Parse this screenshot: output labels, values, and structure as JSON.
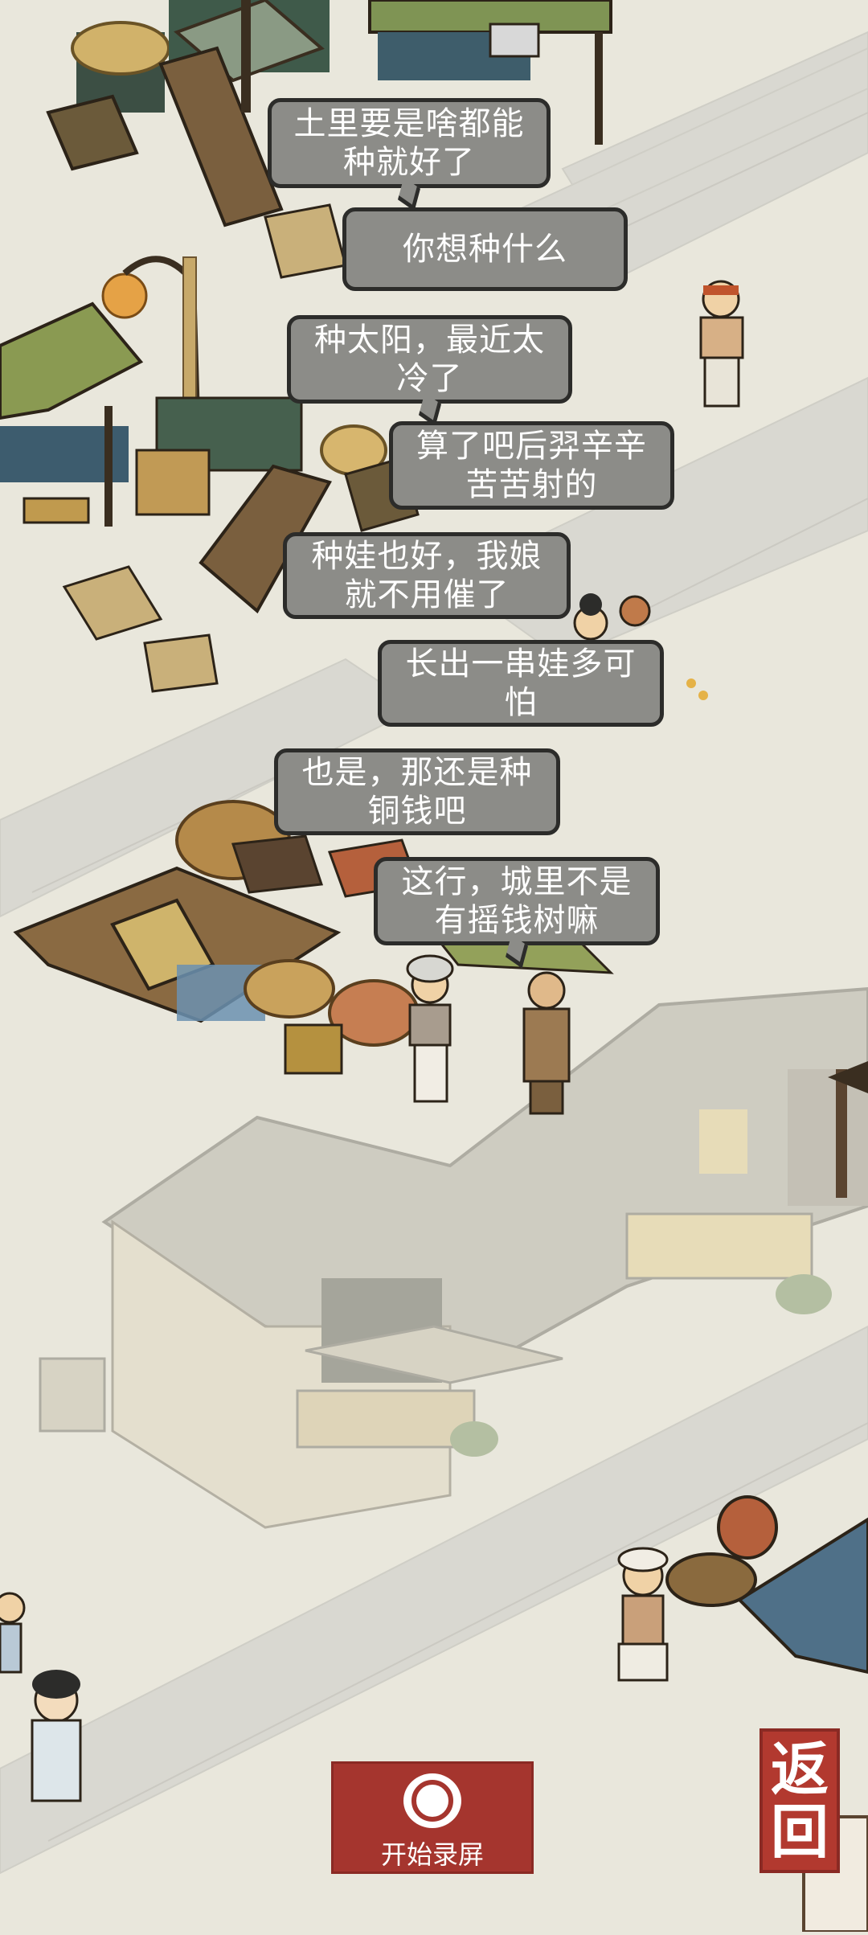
{
  "dialogue": [
    "土里要是啥都能\n种就好了",
    "你想种什么",
    "种太阳，最近太\n冷了",
    "算了吧后羿辛辛\n苦苦射的",
    "种娃也好，我娘\n就不用催了",
    "长出一串娃多可\n怕",
    "也是，那还是种\n铜钱吧",
    "这行，城里不是\n有摇钱树嘛"
  ],
  "controls": {
    "record_label": "开始录屏",
    "back_label_top": "返",
    "back_label_bottom": "回"
  }
}
